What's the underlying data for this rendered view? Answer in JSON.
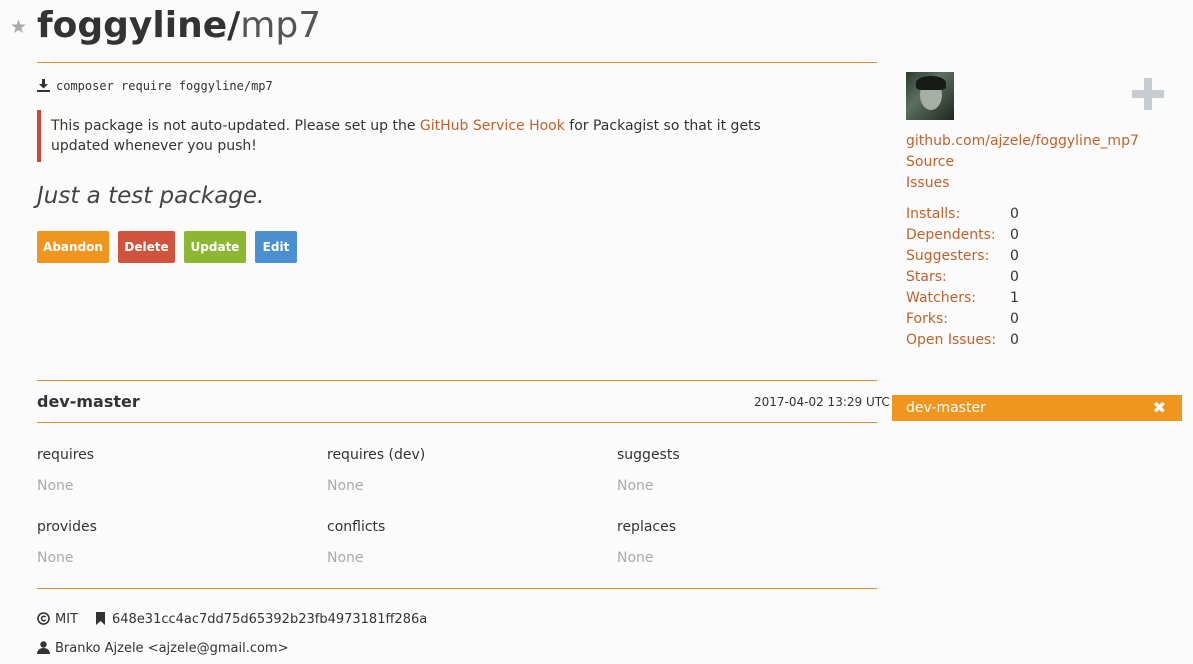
{
  "package": {
    "vendor": "foggyline",
    "slash": "/",
    "name": "mp7",
    "install_command": "composer require foggyline/mp7",
    "notice_prefix": "This package is not auto-updated. Please set up the ",
    "notice_link": "GitHub Service Hook",
    "notice_suffix": " for Packagist so that it gets updated whenever you push!",
    "description": "Just a test package."
  },
  "actions": {
    "abandon": "Abandon",
    "delete": "Delete",
    "update": "Update",
    "edit": "Edit"
  },
  "sidebar": {
    "repo_link": "github.com/ajzele/foggyline_mp7",
    "source_link": "Source",
    "issues_link": "Issues",
    "stats": [
      {
        "label": "Installs:",
        "value": "0"
      },
      {
        "label": "Dependents:",
        "value": "0"
      },
      {
        "label": "Suggesters:",
        "value": "0"
      },
      {
        "label": "Stars:",
        "value": "0"
      },
      {
        "label": "Watchers:",
        "value": "1"
      },
      {
        "label": "Forks:",
        "value": "0"
      },
      {
        "label": "Open Issues:",
        "value": "0"
      }
    ],
    "selected_version": "dev-master",
    "close_glyph": "✖"
  },
  "version": {
    "name": "dev-master",
    "time": "2017-04-02 13:29 UTC",
    "links": [
      {
        "title": "requires",
        "value": "None"
      },
      {
        "title": "requires (dev)",
        "value": "None"
      },
      {
        "title": "suggests",
        "value": "None"
      },
      {
        "title": "provides",
        "value": "None"
      },
      {
        "title": "conflicts",
        "value": "None"
      },
      {
        "title": "replaces",
        "value": "None"
      }
    ],
    "license": "MIT",
    "commit": "648e31cc4ac7dd75d65392b23fb4973181ff286a",
    "author": "Branko Ajzele <ajzele@gmail.com>"
  },
  "colors": {
    "accent": "#f0961f",
    "link": "#c0622a",
    "danger": "#d0543d",
    "success": "#8db732",
    "info": "#4a90d0"
  }
}
